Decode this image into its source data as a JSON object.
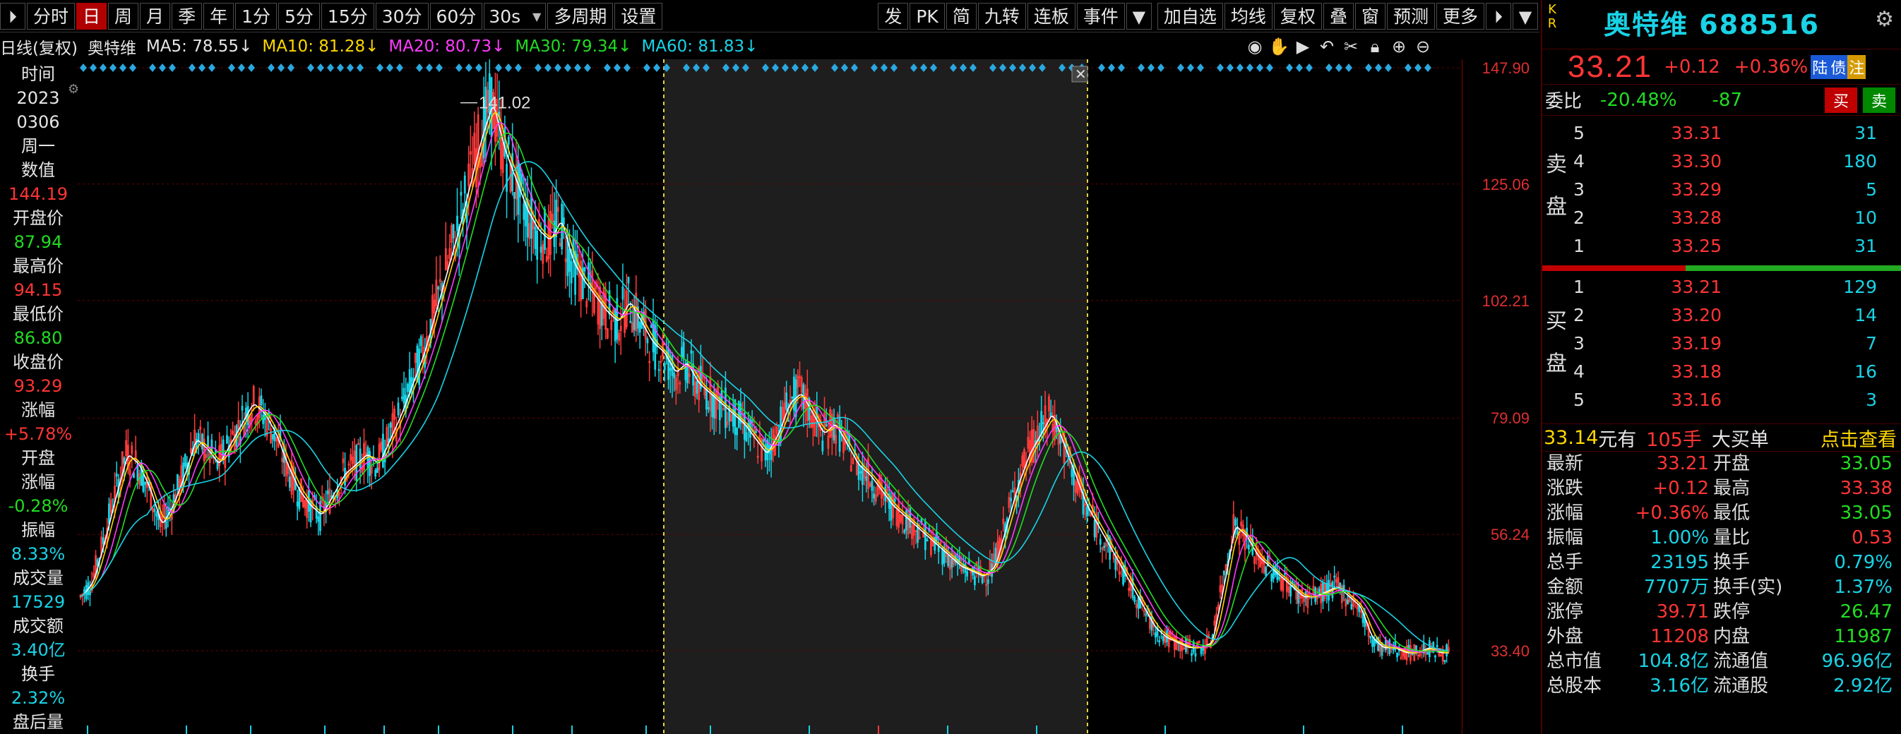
{
  "toolbar": {
    "items": [
      "分时",
      "日",
      "周",
      "月",
      "季",
      "年",
      "1分",
      "5分",
      "15分",
      "30分",
      "60分"
    ],
    "interval_select": "30s",
    "items2": [
      "多周期",
      "设置"
    ],
    "right_items": [
      "发",
      "PK",
      "简",
      "九转",
      "连板",
      "事件"
    ],
    "right_items2": [
      "加自选",
      "均线",
      "复权",
      "叠",
      "窗",
      "预测",
      "更多"
    ]
  },
  "legend": {
    "period": "日线(复权)",
    "stock": "奥特维",
    "ma5": "MA5: 78.55↓",
    "ma10": "MA10: 81.28↓",
    "ma20": "MA20: 80.73↓",
    "ma30": "MA30: 79.34↓",
    "ma60": "MA60: 81.83↓"
  },
  "info": {
    "time_label": "时间",
    "year": "2023",
    "date": "0306",
    "weekday": "周一",
    "value_label": "数值",
    "value": "144.19",
    "open_label": "开盘价",
    "open": "87.94",
    "high_label": "最高价",
    "high": "94.15",
    "low_label": "最低价",
    "low": "86.80",
    "close_label": "收盘价",
    "close": "93.29",
    "chg_label": "涨幅",
    "chg": "+5.78%",
    "open_chg_label1": "开盘",
    "open_chg_label2": "涨幅",
    "open_chg": "-0.28%",
    "amp_label": "振幅",
    "amp": "8.33%",
    "vol_label": "成交量",
    "vol": "17529",
    "amt_label": "成交额",
    "amt": "3.40亿",
    "turn_label": "换手",
    "turn": "2.32%",
    "after_label": "盘后量"
  },
  "chart_data": {
    "type": "candlestick",
    "y_ticks": [
      "147.90",
      "125.06",
      "102.21",
      "79.09",
      "56.24",
      "33.40"
    ],
    "ylim": [
      33.4,
      147.9
    ],
    "max_label": "141.02",
    "colors": {
      "up": "#ff3b3b",
      "down": "#19d3e6",
      "ma5": "#ffffff",
      "ma10": "#ffd700",
      "ma20": "#ff3cff",
      "ma30": "#22dd22",
      "ma60": "#19d3e6"
    },
    "close_series": [
      44,
      47,
      55,
      64,
      72,
      70,
      65,
      58,
      62,
      68,
      75,
      73,
      70,
      74,
      78,
      82,
      80,
      76,
      70,
      65,
      62,
      60,
      64,
      68,
      70,
      72,
      70,
      75,
      80,
      86,
      92,
      100,
      108,
      116,
      125,
      134,
      141,
      132,
      126,
      120,
      116,
      114,
      118,
      110,
      106,
      103,
      100,
      98,
      102,
      98,
      94,
      92,
      88,
      90,
      86,
      84,
      82,
      80,
      78,
      75,
      72,
      76,
      82,
      84,
      80,
      76,
      78,
      74,
      70,
      68,
      65,
      62,
      60,
      58,
      56,
      54,
      52,
      50,
      49,
      48,
      50,
      58,
      66,
      72,
      76,
      80,
      74,
      68,
      62,
      58,
      54,
      50,
      46,
      42,
      38,
      36,
      35,
      34,
      34,
      35,
      46,
      58,
      56,
      52,
      50,
      48,
      46,
      44,
      44,
      45,
      46,
      44,
      42,
      36,
      34,
      34,
      33,
      33,
      34,
      33
    ]
  },
  "side": {
    "kr": "K R",
    "name": "奥特维 688516",
    "price": "33.21",
    "chg": "+0.12",
    "pct": "+0.36%",
    "tags": [
      "陆",
      "债",
      "注"
    ],
    "weibi_label": "委比",
    "weibi": "-20.48%",
    "weicha": "-87",
    "buy_btn": "买",
    "sell_btn": "卖",
    "sell_side_label": [
      "卖",
      "盘"
    ],
    "buy_side_label": [
      "买",
      "盘"
    ],
    "asks": [
      {
        "lvl": "5",
        "price": "33.31",
        "vol": "31"
      },
      {
        "lvl": "4",
        "price": "33.30",
        "vol": "180"
      },
      {
        "lvl": "3",
        "price": "33.29",
        "vol": "5"
      },
      {
        "lvl": "2",
        "price": "33.28",
        "vol": "10"
      },
      {
        "lvl": "1",
        "price": "33.25",
        "vol": "31"
      }
    ],
    "bids": [
      {
        "lvl": "1",
        "price": "33.21",
        "vol": "129"
      },
      {
        "lvl": "2",
        "price": "33.20",
        "vol": "14"
      },
      {
        "lvl": "3",
        "price": "33.19",
        "vol": "7"
      },
      {
        "lvl": "4",
        "price": "33.18",
        "vol": "16"
      },
      {
        "lvl": "5",
        "price": "33.16",
        "vol": "3"
      }
    ],
    "big_order": {
      "price": "33.14",
      "unit": "元有",
      "qty": "105手",
      "label": "大买单",
      "link": "点击查看"
    },
    "quotes": [
      [
        "最新",
        "33.21",
        "开盘",
        "33.05"
      ],
      [
        "涨跌",
        "+0.12",
        "最高",
        "33.38"
      ],
      [
        "涨幅",
        "+0.36%",
        "最低",
        "33.05"
      ],
      [
        "振幅",
        "1.00%",
        "量比",
        "0.53"
      ],
      [
        "总手",
        "23195",
        "换手",
        "0.79%"
      ],
      [
        "金额",
        "7707万",
        "换手(实)",
        "1.37%"
      ],
      [
        "涨停",
        "39.71",
        "跌停",
        "26.47"
      ],
      [
        "外盘",
        "11208",
        "内盘",
        "11987"
      ],
      [
        "总市值",
        "104.8亿",
        "流通值",
        "96.96亿"
      ],
      [
        "总股本",
        "3.16亿",
        "流通股",
        "2.92亿"
      ]
    ]
  }
}
